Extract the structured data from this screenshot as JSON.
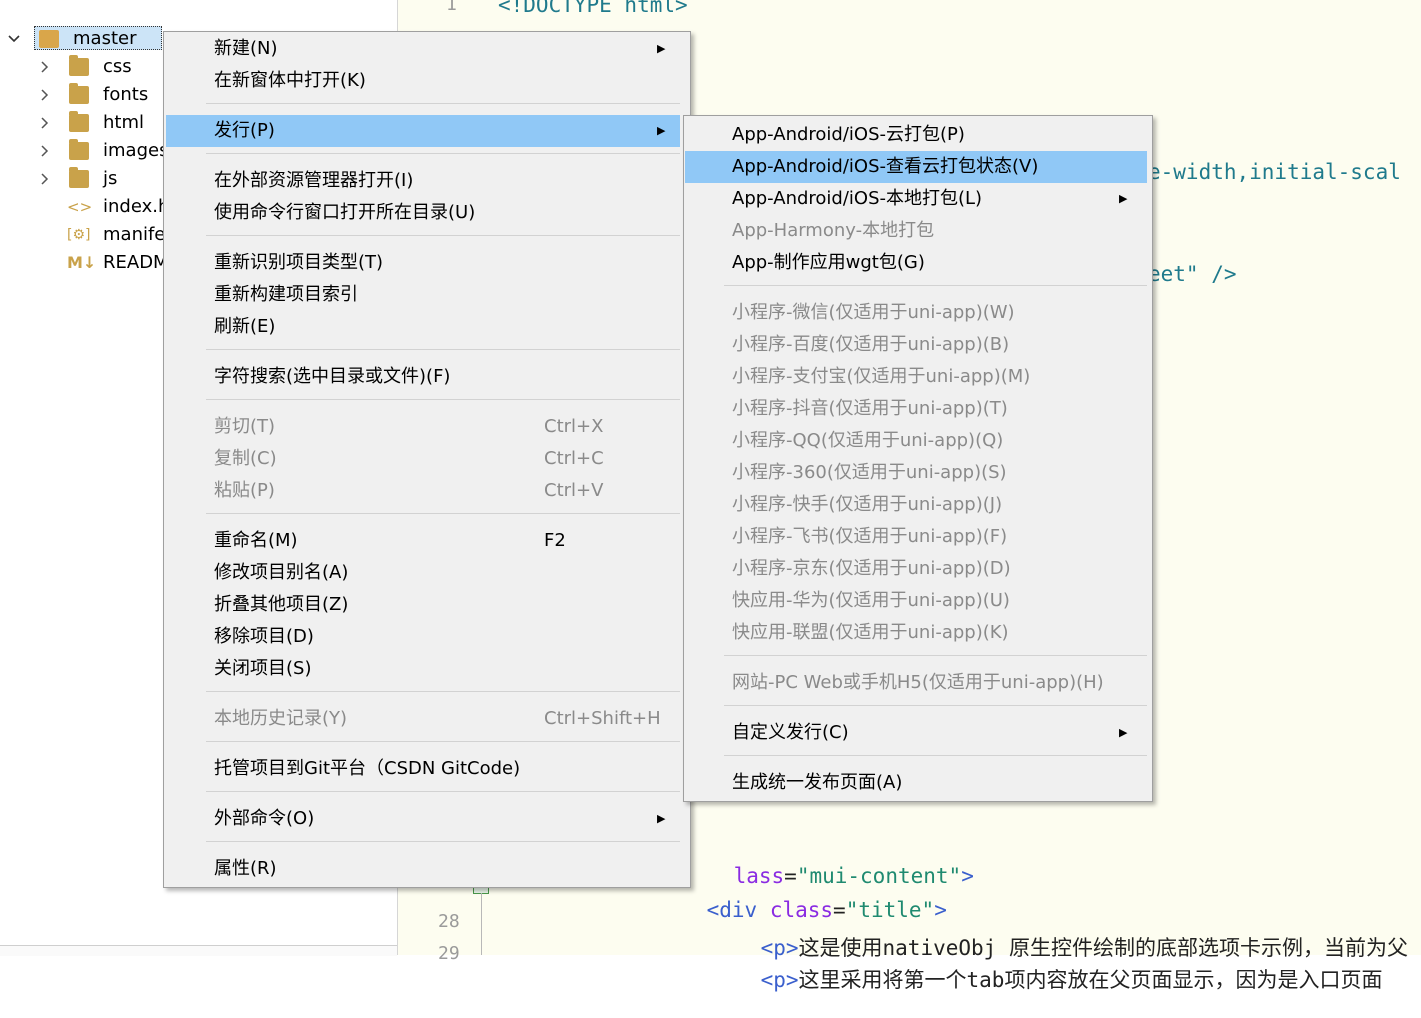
{
  "tree": {
    "root": {
      "label": "master",
      "icon": "uniapp-project-icon"
    },
    "items": [
      {
        "label": "css",
        "type": "folder"
      },
      {
        "label": "fonts",
        "type": "folder"
      },
      {
        "label": "html",
        "type": "folder"
      },
      {
        "label": "images",
        "type": "folder"
      },
      {
        "label": "js",
        "type": "folder"
      },
      {
        "label": "index.h",
        "type": "html-file",
        "icon_text": "<>"
      },
      {
        "label": "manife",
        "type": "json-file",
        "icon_text": "[⚙]"
      },
      {
        "label": "READM",
        "type": "md-file",
        "icon_text": "M↓"
      }
    ]
  },
  "editor": {
    "line_numbers": {
      "l1": "1",
      "l28": "28",
      "l29": "29"
    },
    "snippets": {
      "doctype": "<!DOCTYPE html>",
      "meta_frag": "e-width,initial-scal",
      "link_frag": "eet\" />",
      "div1_lt": "<",
      "div1_attr": "lass",
      "div1_eq": "=",
      "div1_val": "\"mui-content\"",
      "div1_gt": ">",
      "div2_tag": "<div",
      "div2_attr": "class",
      "div2_eq": "=",
      "div2_val": "\"title\"",
      "div2_gt": ">",
      "p1_tag": "<p>",
      "p1_text": "这是使用nativeObj 原生控件绘制的底部选项卡示例，当前为父",
      "p2_tag": "<p>",
      "p2_text": "这里采用将第一个tab项内容放在父页面显示，因为是入口页面"
    }
  },
  "context_menu": {
    "items": [
      {
        "label": "新建(N)",
        "submenu": true
      },
      {
        "label": "在新窗体中打开(K)"
      },
      {
        "label": "发行(P)",
        "submenu": true,
        "highlighted": true
      },
      {
        "label": "在外部资源管理器打开(I)"
      },
      {
        "label": "使用命令行窗口打开所在目录(U)"
      },
      {
        "label": "重新识别项目类型(T)"
      },
      {
        "label": "重新构建项目索引"
      },
      {
        "label": "刷新(E)"
      },
      {
        "label": "字符搜索(选中目录或文件)(F)"
      },
      {
        "label": "剪切(T)",
        "shortcut": "Ctrl+X",
        "disabled": true
      },
      {
        "label": "复制(C)",
        "shortcut": "Ctrl+C",
        "disabled": true
      },
      {
        "label": "粘贴(P)",
        "shortcut": "Ctrl+V",
        "disabled": true
      },
      {
        "label": "重命名(M)",
        "shortcut": "F2"
      },
      {
        "label": "修改项目别名(A)"
      },
      {
        "label": "折叠其他项目(Z)"
      },
      {
        "label": "移除项目(D)"
      },
      {
        "label": "关闭项目(S)"
      },
      {
        "label": "本地历史记录(Y)",
        "shortcut": "Ctrl+Shift+H",
        "disabled": true
      },
      {
        "label": "托管项目到Git平台（CSDN GitCode)"
      },
      {
        "label": "外部命令(O)",
        "submenu": true
      },
      {
        "label": "属性(R)"
      }
    ]
  },
  "publish_submenu": {
    "items": [
      {
        "label": "App-Android/iOS-云打包(P)"
      },
      {
        "label": "App-Android/iOS-查看云打包状态(V)",
        "highlighted": true
      },
      {
        "label": "App-Android/iOS-本地打包(L)",
        "submenu": true
      },
      {
        "label": "App-Harmony-本地打包",
        "disabled": true
      },
      {
        "label": "App-制作应用wgt包(G)"
      },
      {
        "label": "小程序-微信(仅适用于uni-app)(W)",
        "disabled": true
      },
      {
        "label": "小程序-百度(仅适用于uni-app)(B)",
        "disabled": true
      },
      {
        "label": "小程序-支付宝(仅适用于uni-app)(M)",
        "disabled": true
      },
      {
        "label": "小程序-抖音(仅适用于uni-app)(T)",
        "disabled": true
      },
      {
        "label": "小程序-QQ(仅适用于uni-app)(Q)",
        "disabled": true
      },
      {
        "label": "小程序-360(仅适用于uni-app)(S)",
        "disabled": true
      },
      {
        "label": "小程序-快手(仅适用于uni-app)(J)",
        "disabled": true
      },
      {
        "label": "小程序-飞书(仅适用于uni-app)(F)",
        "disabled": true
      },
      {
        "label": "小程序-京东(仅适用于uni-app)(D)",
        "disabled": true
      },
      {
        "label": "快应用-华为(仅适用于uni-app)(U)",
        "disabled": true
      },
      {
        "label": "快应用-联盟(仅适用于uni-app)(K)",
        "disabled": true
      },
      {
        "label": "网站-PC Web或手机H5(仅适用于uni-app)(H)",
        "disabled": true
      },
      {
        "label": "自定义发行(C)",
        "submenu": true
      },
      {
        "label": "生成统一发布页面(A)"
      }
    ]
  },
  "colors": {
    "highlight": "#90c8f6",
    "menu_bg": "#f0f0f0",
    "disabled_text": "#8a8a8a",
    "folder": "#c9a24a"
  }
}
